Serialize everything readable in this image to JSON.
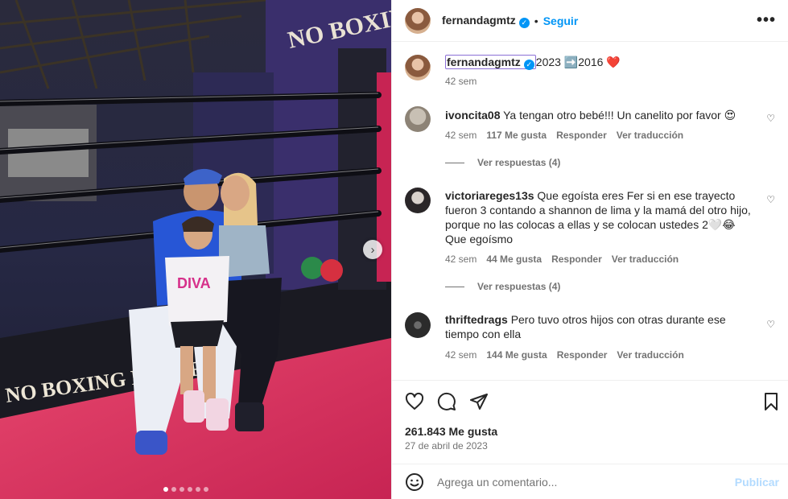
{
  "post": {
    "username": "fernandagmtz",
    "follow_label": "Seguir",
    "more_label": "•••",
    "caption_text": "2023 ➡️2016 ❤️",
    "caption_time": "42 sem",
    "likes": "261.843 Me gusta",
    "date": "27 de abril de 2023"
  },
  "comments": [
    {
      "user": "ivoncita08",
      "text": "Ya tengan otro bebé!!! Un canelito por favor 😍",
      "time": "42 sem",
      "likes": "117 Me gusta",
      "reply": "Responder",
      "translate": "Ver traducción",
      "replies": "Ver respuestas (4)"
    },
    {
      "user": "victoriareges13s",
      "text": "Que egoísta eres Fer si en ese trayecto fueron 3 contando a shannon de lima y la mamá del otro hijo, porque no las colocas a ellas y se colocan ustedes 2🤍😂 Que egoísmo",
      "time": "42 sem",
      "likes": "44 Me gusta",
      "reply": "Responder",
      "translate": "Ver traducción",
      "replies": "Ver respuestas (4)"
    },
    {
      "user": "thriftedrags",
      "text": "Pero tuvo otros hijos con otras durante ese tiempo con ella",
      "time": "42 sem",
      "likes": "144 Me gusta",
      "reply": "Responder",
      "translate": "Ver traducción"
    }
  ],
  "add_comment": {
    "placeholder": "Agrega un comentario...",
    "publish_label": "Publicar"
  },
  "media": {
    "banner_text_top": "NO BOXING",
    "banner_text_left": "NO BOXING NO LIFE",
    "shirt_text": "DIVA",
    "carousel_total": 6,
    "carousel_active": 1
  },
  "colors": {
    "accent": "#0095f6",
    "text": "#262626",
    "muted": "#737373",
    "publish_disabled": "#b3dbff",
    "ring_floor": "#d8305c"
  }
}
